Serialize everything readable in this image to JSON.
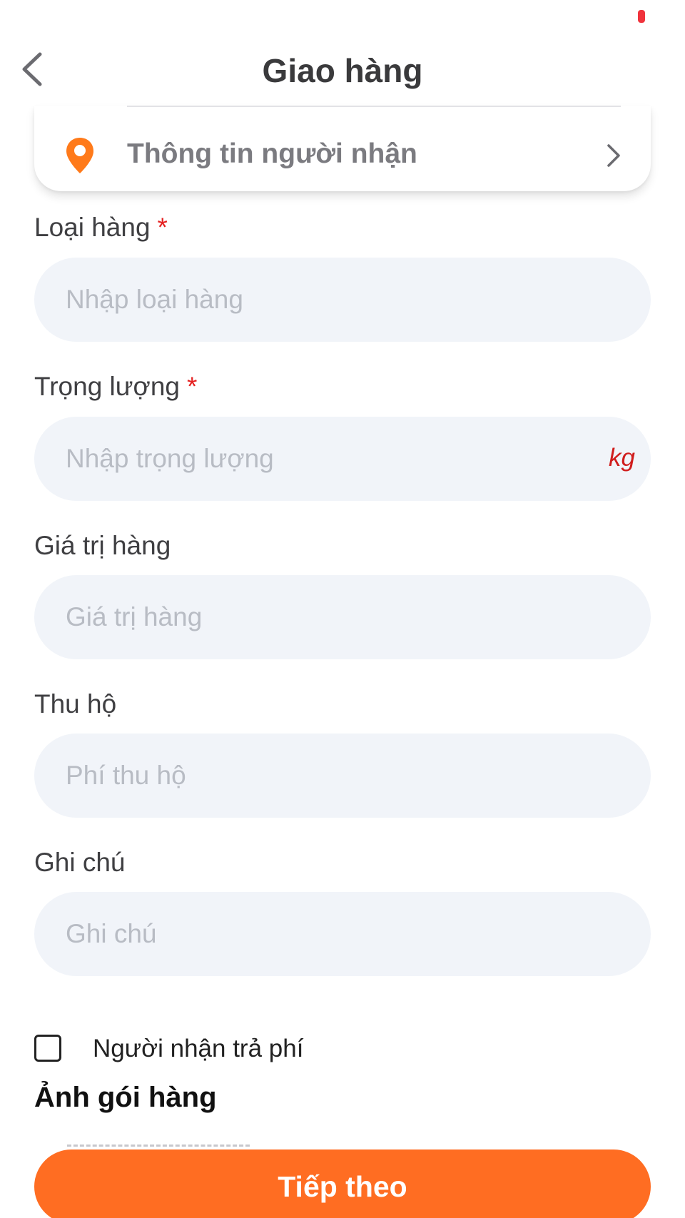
{
  "header": {
    "title": "Giao hàng"
  },
  "recipient": {
    "label": "Thông tin người nhận"
  },
  "form": {
    "fields": [
      {
        "label": "Loại hàng",
        "required_mark": "*",
        "placeholder": "Nhập loại hàng",
        "value": ""
      },
      {
        "label": "Trọng lượng",
        "required_mark": "*",
        "placeholder": "Nhập trọng lượng",
        "unit": "kg",
        "value": ""
      },
      {
        "label": "Giá trị hàng",
        "placeholder": "Giá trị hàng",
        "value": ""
      },
      {
        "label": "Thu hộ",
        "placeholder": "Phí thu hộ",
        "value": ""
      },
      {
        "label": "Ghi chú",
        "placeholder": "Ghi chú",
        "value": ""
      }
    ],
    "payer_checkbox": {
      "label": "Người nhận trả phí",
      "checked": false
    }
  },
  "package_photo": {
    "title": "Ảnh gói hàng"
  },
  "actions": {
    "next_label": "Tiếp theo"
  },
  "icons": {
    "back": "chevron-left-icon",
    "location": "location-pin-icon",
    "forward": "chevron-right-icon"
  },
  "colors": {
    "accent": "#ff6d22",
    "pin": "#ff7a1a",
    "required": "#e52222",
    "input_bg": "#f1f4f9",
    "status": "#f0333c"
  }
}
